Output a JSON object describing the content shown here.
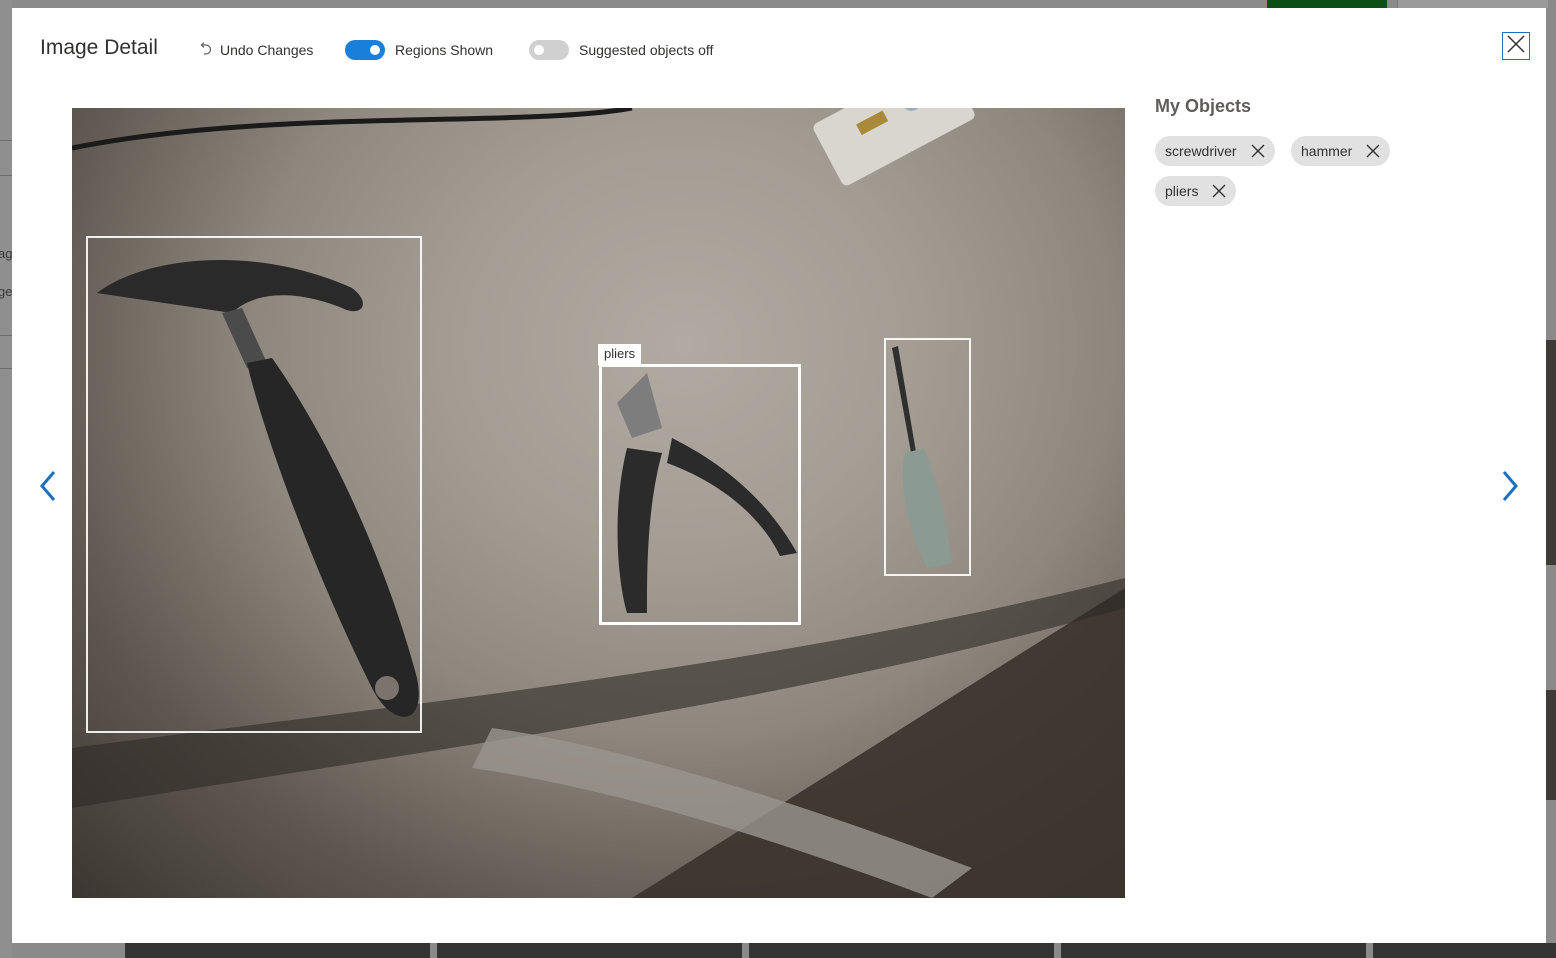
{
  "modal": {
    "title": "Image Detail",
    "undo_label": "Undo Changes",
    "regions_toggle": {
      "label": "Regions Shown",
      "on": true
    },
    "suggested_toggle": {
      "label": "Suggested objects off",
      "on": false
    }
  },
  "regions": [
    {
      "name": "hammer",
      "show_tag": false,
      "selected": false
    },
    {
      "name": "pliers",
      "show_tag": true,
      "selected": true
    },
    {
      "name": "screwdriver",
      "show_tag": false,
      "selected": false
    }
  ],
  "objects_panel": {
    "title": "My Objects",
    "tags": [
      "screwdriver",
      "hammer",
      "pliers"
    ]
  },
  "background_app": {
    "sidebar_fragments": [
      "ag",
      "ge"
    ]
  },
  "colors": {
    "accent": "#1a7fd8",
    "close_border": "#1a6fbf",
    "nav_arrow": "#1a6fbf",
    "chip_bg": "#e1e1e1"
  },
  "icons": {
    "undo": "undo-icon",
    "close": "close-icon",
    "prev": "chevron-left-icon",
    "next": "chevron-right-icon",
    "remove_tag": "remove-icon"
  }
}
